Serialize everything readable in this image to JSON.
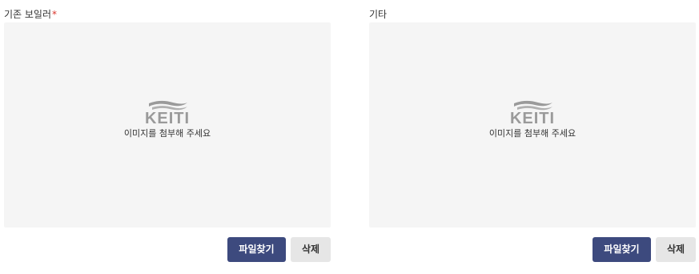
{
  "panels": [
    {
      "label": "기존 보일러",
      "required_mark": "*",
      "dropzone": {
        "logo_text": "KEITI",
        "hint": "이미지를 첨부해 주세요"
      },
      "buttons": {
        "find": "파일찾기",
        "delete": "삭제"
      }
    },
    {
      "label": "기타",
      "dropzone": {
        "logo_text": "KEITI",
        "hint": "이미지를 첨부해 주세요"
      },
      "buttons": {
        "find": "파일찾기",
        "delete": "삭제"
      }
    }
  ],
  "colors": {
    "primary_button": "#3d4a7e",
    "secondary_button": "#e6e6e6",
    "dropzone_bg": "#f5f5f5",
    "required": "#d9342b",
    "logo": "#9a9a9a"
  }
}
